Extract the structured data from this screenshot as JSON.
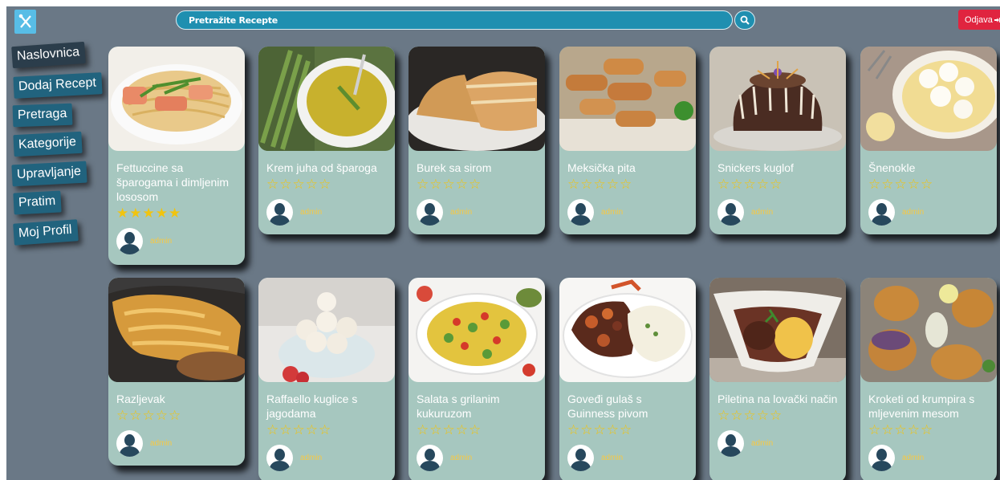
{
  "search": {
    "placeholder": "Pretražite Recepte"
  },
  "header": {
    "logout_label": "Odjava"
  },
  "sidebar": {
    "items": [
      {
        "label": "Naslovnica"
      },
      {
        "label": "Dodaj Recept"
      },
      {
        "label": "Pretraga"
      },
      {
        "label": "Kategorije"
      },
      {
        "label": "Upravljanje"
      },
      {
        "label": "Pratim"
      },
      {
        "label": "Moj Profil"
      }
    ]
  },
  "recipes": [
    {
      "title": "Fettuccine sa šparogama i dimljenim lososom",
      "rating": 5,
      "author": "admin",
      "image": "pasta with salmon and asparagus"
    },
    {
      "title": "Krem juha od šparoga",
      "rating": 0,
      "author": "admin",
      "image": "asparagus cream soup"
    },
    {
      "title": "Burek sa sirom",
      "rating": 0,
      "author": "admin",
      "image": "cheese burek"
    },
    {
      "title": "Meksička pita",
      "rating": 0,
      "author": "admin",
      "image": "pastry rolls"
    },
    {
      "title": "Snickers kuglof",
      "rating": 0,
      "author": "admin",
      "image": "chocolate bundt cake"
    },
    {
      "title": "Šnenokle",
      "rating": 0,
      "author": "admin",
      "image": "snow dumplings in custard"
    },
    {
      "title": "Razljevak",
      "rating": 0,
      "author": "admin",
      "image": "baked batter pie"
    },
    {
      "title": "Raffaello kuglice s jagodama",
      "rating": 0,
      "author": "admin",
      "image": "coconut balls with strawberries"
    },
    {
      "title": "Salata s grilanim kukuruzom",
      "rating": 0,
      "author": "admin",
      "image": "grilled corn salad"
    },
    {
      "title": "Goveđi gulaš s Guinness pivom",
      "rating": 0,
      "author": "admin",
      "image": "beef stew with mashed potatoes"
    },
    {
      "title": "Piletina na lovački način",
      "rating": 0,
      "author": "admin",
      "image": "hunter style chicken"
    },
    {
      "title": "Kroketi od krumpira s mljevenim mesom",
      "rating": 0,
      "author": "admin",
      "image": "potato croquettes"
    }
  ],
  "colors": {
    "background": "#6a7886",
    "card": "#a6c7bf",
    "accent": "#1f8fb0",
    "logout": "#e0243f",
    "star": "#f1c40f"
  },
  "icons": [
    "logo-icon",
    "search-icon",
    "logout-icon",
    "star-icon",
    "avatar-icon"
  ]
}
